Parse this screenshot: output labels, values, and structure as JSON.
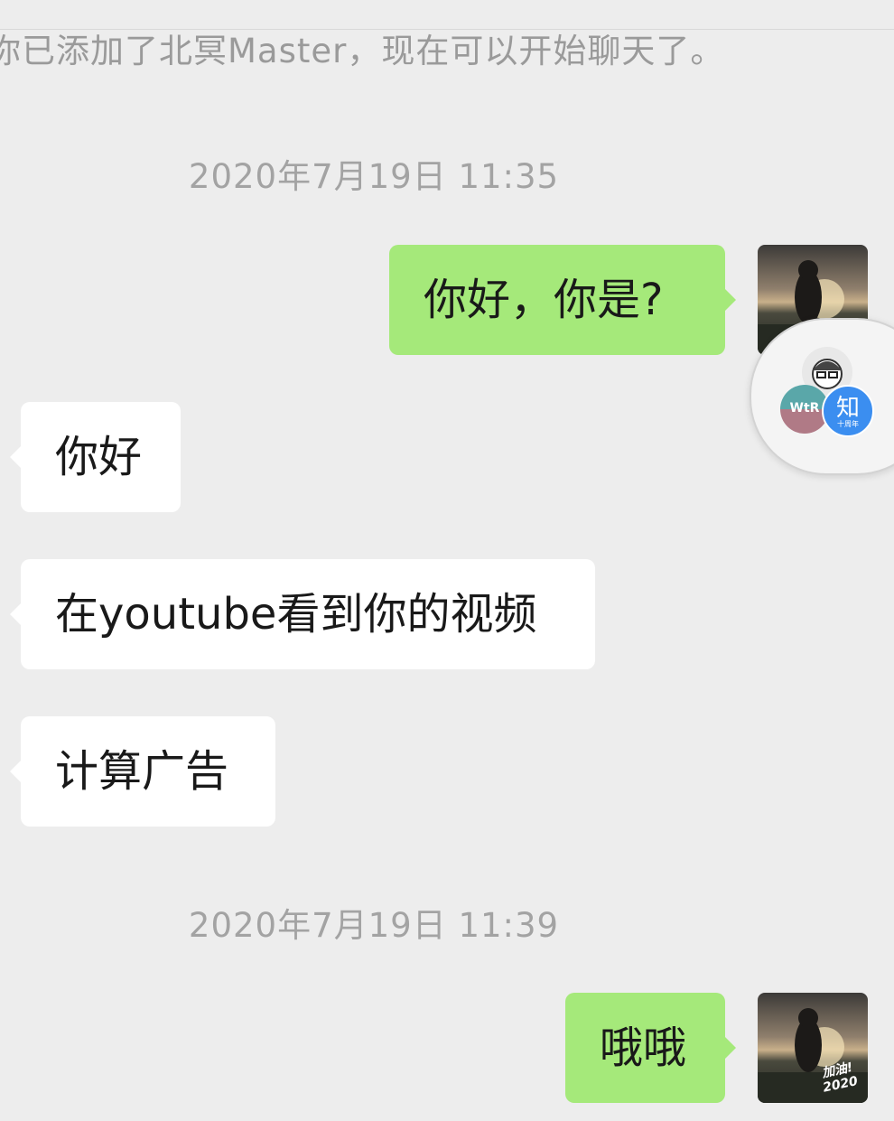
{
  "system_message": "你已添加了北冥Master，现在可以开始聊天了。",
  "timestamps": [
    "2020年7月19日 11:35",
    "2020年7月19日 11:39"
  ],
  "messages": [
    {
      "side": "out",
      "text": "你好，你是?"
    },
    {
      "side": "in",
      "text": "你好"
    },
    {
      "side": "in",
      "text": "在youtube看到你的视频"
    },
    {
      "side": "in",
      "text": "计算广告"
    },
    {
      "side": "out",
      "text": "哦哦"
    }
  ],
  "avatar_caption": "加油! 2020",
  "floating_window": {
    "icons": [
      "person-with-glasses-icon",
      "wtr-logo-icon",
      "zhihu-icon"
    ],
    "zhihu_label": "知",
    "zhihu_sub": "十周年",
    "wtr_label": "WtR"
  },
  "colors": {
    "background": "#ededed",
    "outgoing_bubble": "#a5e97a",
    "incoming_bubble": "#ffffff",
    "zhihu_blue": "#3b8ef0"
  }
}
